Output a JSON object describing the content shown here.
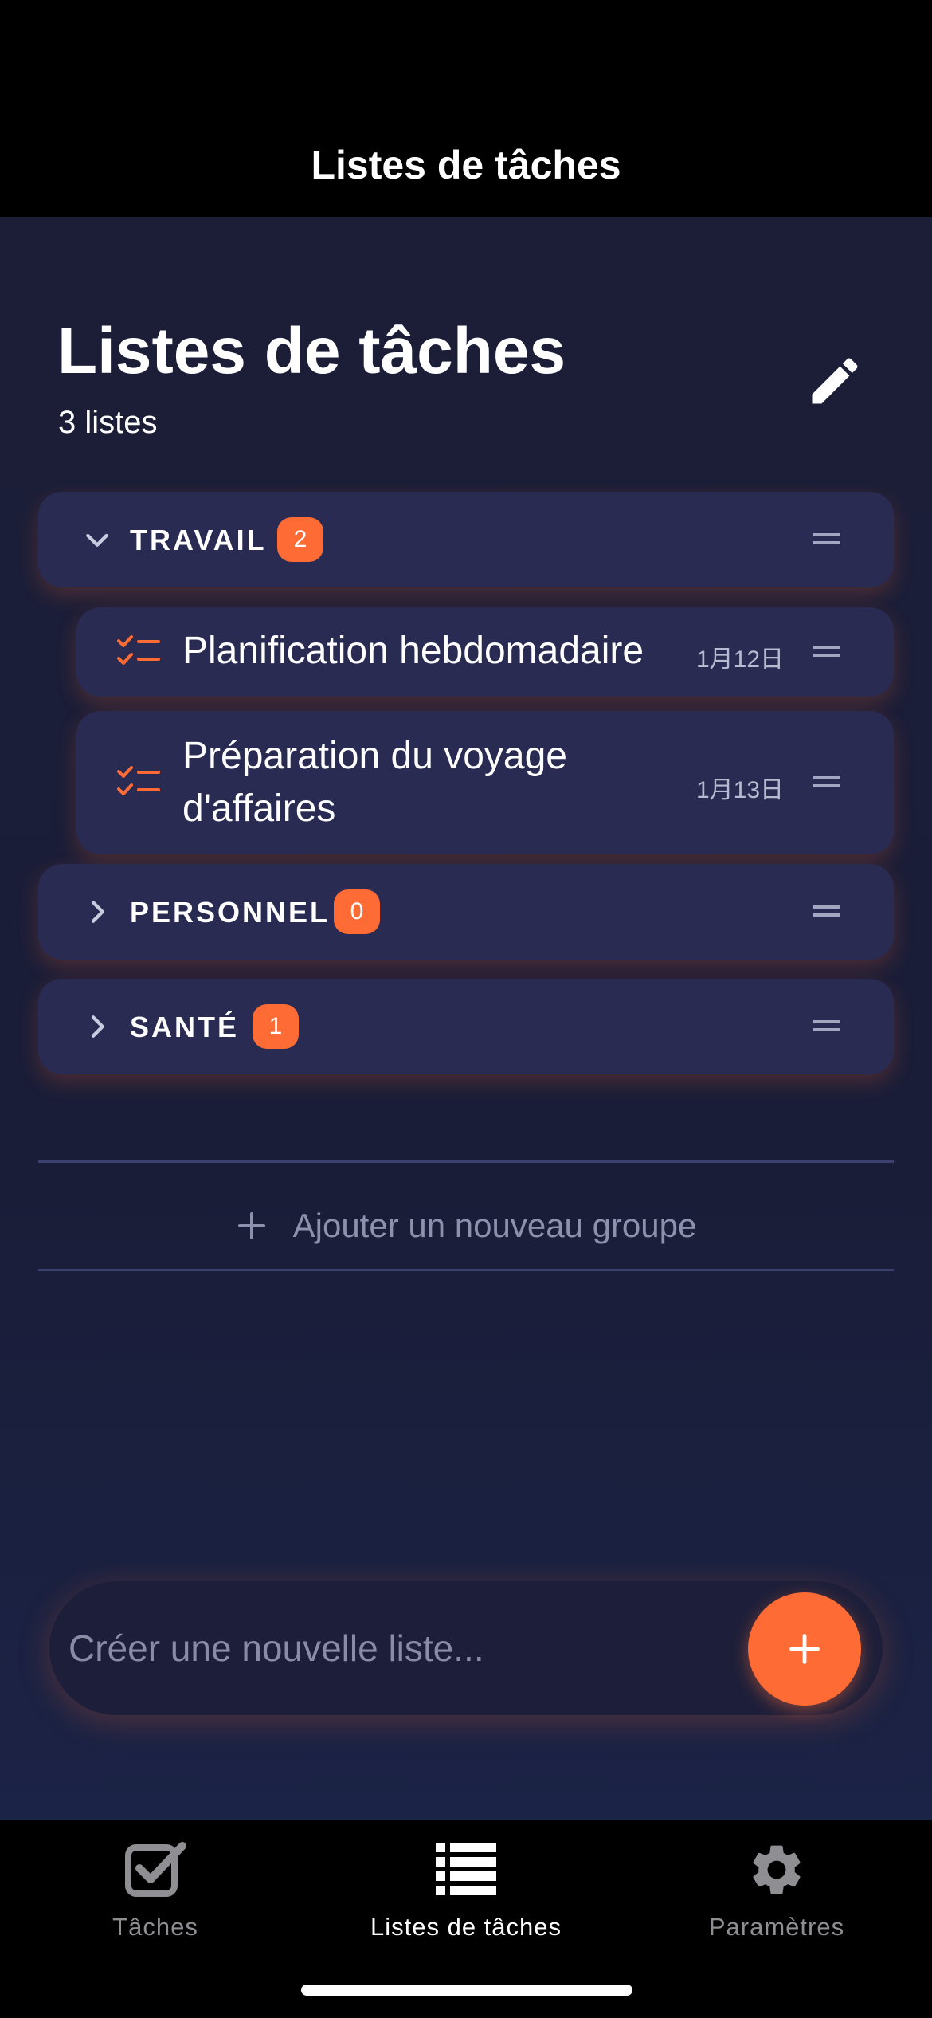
{
  "nav": {
    "title": "Listes de tâches"
  },
  "header": {
    "title": "Listes de tâches",
    "subtitle": "3 listes",
    "edit_icon": "pencil-icon"
  },
  "groups": [
    {
      "name": "TRAVAIL",
      "count": "2",
      "expanded": true,
      "lists": [
        {
          "title": "Planification hebdomadaire",
          "date": "1月12日"
        },
        {
          "title_line1": "Préparation du voyage",
          "title_line2": "d'affaires",
          "date": "1月13日"
        }
      ]
    },
    {
      "name": "PERSONNEL",
      "count": "0",
      "expanded": false
    },
    {
      "name": "SANTÉ",
      "count": "1",
      "expanded": false
    }
  ],
  "add_group": {
    "label": "Ajouter un nouveau groupe"
  },
  "composer": {
    "placeholder": "Créer une nouvelle liste..."
  },
  "tabbar": {
    "tabs": [
      {
        "label": "Tâches",
        "icon": "checkbox-icon",
        "active": false
      },
      {
        "label": "Listes de tâches",
        "icon": "list-icon",
        "active": true
      },
      {
        "label": "Paramètres",
        "icon": "gear-icon",
        "active": false
      }
    ]
  },
  "colors": {
    "accent": "#ff6b35",
    "card": "#292b52",
    "background": "#1c1e38",
    "inactive_tab": "#8e8e93"
  }
}
